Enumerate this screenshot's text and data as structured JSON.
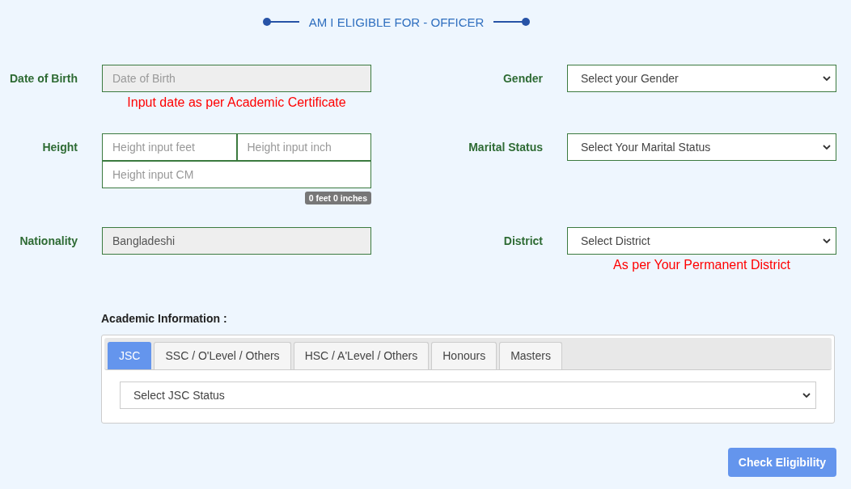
{
  "title": "AM I ELIGIBLE FOR - OFFICER",
  "rows": [
    {
      "left": {
        "label": "Date of Birth",
        "kind": "input",
        "disabled": true,
        "lines": [
          [
            {
              "placeholder": "Date of Birth"
            }
          ]
        ],
        "hint": "Input date as per Academic Certificate"
      },
      "right": {
        "label": "Gender",
        "kind": "select",
        "value": "Select your Gender"
      }
    },
    {
      "left": {
        "label": "Height",
        "kind": "input",
        "disabled": false,
        "lines": [
          [
            {
              "placeholder": "Height input feet"
            },
            {
              "placeholder": "Height input inch"
            }
          ],
          [
            {
              "placeholder": "Height input CM"
            }
          ]
        ],
        "badge": "0 feet 0 inches"
      },
      "right": {
        "label": "Marital Status",
        "kind": "select",
        "value": "Select Your Marital Status"
      }
    },
    {
      "left": {
        "label": "Nationality",
        "kind": "input",
        "disabled": true,
        "lines": [
          [
            {
              "value": "Bangladeshi"
            }
          ]
        ]
      },
      "right": {
        "label": "District",
        "kind": "select",
        "value": "Select District",
        "hint": "As per Your Permanent District"
      }
    }
  ],
  "academic": {
    "label": "Academic Information :",
    "tabs": [
      {
        "label": "JSC",
        "selected": true
      },
      {
        "label": "SSC / O'Level / Others",
        "selected": false
      },
      {
        "label": "HSC / A'Level / Others",
        "selected": false
      },
      {
        "label": "Honours",
        "selected": false
      },
      {
        "label": "Masters",
        "selected": false
      }
    ],
    "status_select": "Select JSC Status"
  },
  "button": "Check Eligibility"
}
